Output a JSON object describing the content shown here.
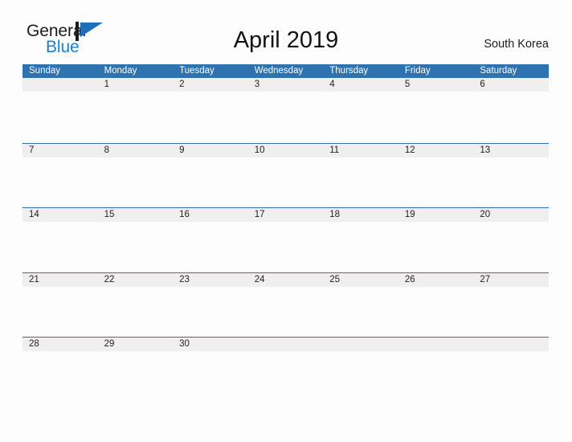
{
  "brand": {
    "name_part1": "General",
    "name_part2": "Blue",
    "mark_icon": "triangle-flag-icon",
    "color_primary": "#1b7fd4",
    "color_text": "#1b1b1b"
  },
  "header": {
    "title": "April 2019",
    "region": "South Korea"
  },
  "calendar": {
    "month": "April",
    "year": "2019",
    "header_color": "#2e72b0",
    "band_color": "#efefef",
    "weekdays": [
      "Sunday",
      "Monday",
      "Tuesday",
      "Wednesday",
      "Thursday",
      "Friday",
      "Saturday"
    ],
    "weeks": [
      {
        "days": [
          {
            "label": "",
            "empty": true
          },
          {
            "label": "1",
            "empty": false
          },
          {
            "label": "2",
            "empty": false
          },
          {
            "label": "3",
            "empty": false
          },
          {
            "label": "4",
            "empty": false
          },
          {
            "label": "5",
            "empty": false
          },
          {
            "label": "6",
            "empty": false
          }
        ]
      },
      {
        "days": [
          {
            "label": "7",
            "empty": false
          },
          {
            "label": "8",
            "empty": false
          },
          {
            "label": "9",
            "empty": false
          },
          {
            "label": "10",
            "empty": false
          },
          {
            "label": "11",
            "empty": false
          },
          {
            "label": "12",
            "empty": false
          },
          {
            "label": "13",
            "empty": false
          }
        ]
      },
      {
        "days": [
          {
            "label": "14",
            "empty": false
          },
          {
            "label": "15",
            "empty": false
          },
          {
            "label": "16",
            "empty": false
          },
          {
            "label": "17",
            "empty": false
          },
          {
            "label": "18",
            "empty": false
          },
          {
            "label": "19",
            "empty": false
          },
          {
            "label": "20",
            "empty": false
          }
        ]
      },
      {
        "days": [
          {
            "label": "21",
            "empty": false
          },
          {
            "label": "22",
            "empty": false
          },
          {
            "label": "23",
            "empty": false
          },
          {
            "label": "24",
            "empty": false
          },
          {
            "label": "25",
            "empty": false
          },
          {
            "label": "26",
            "empty": false
          },
          {
            "label": "27",
            "empty": false
          }
        ]
      },
      {
        "days": [
          {
            "label": "28",
            "empty": false
          },
          {
            "label": "29",
            "empty": false
          },
          {
            "label": "30",
            "empty": false
          },
          {
            "label": "",
            "empty": true
          },
          {
            "label": "",
            "empty": true
          },
          {
            "label": "",
            "empty": true
          },
          {
            "label": "",
            "empty": true
          }
        ]
      }
    ]
  }
}
